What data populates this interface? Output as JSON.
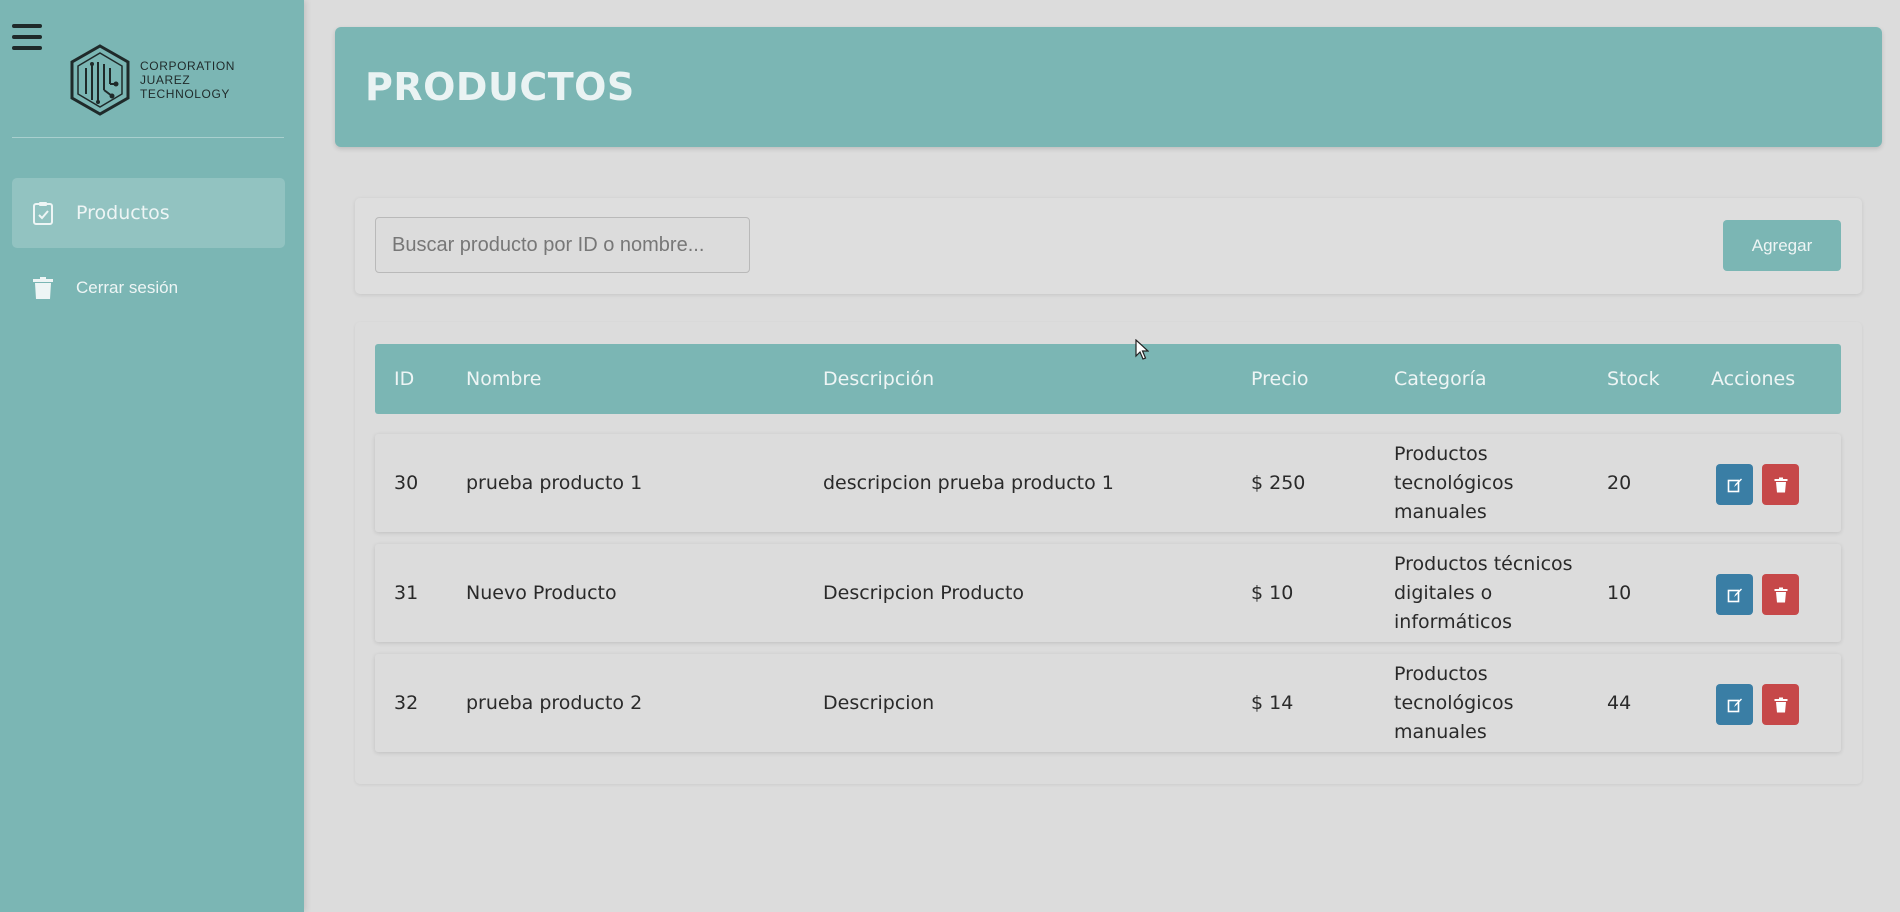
{
  "sidebar": {
    "logo_lines": [
      "CORPORATION",
      "JUAREZ",
      "TECHNOLOGY"
    ],
    "items": [
      {
        "label": "Productos",
        "icon": "clipboard-check-icon",
        "active": true
      },
      {
        "label": "Cerrar sesión",
        "icon": "trash-icon",
        "active": false
      }
    ]
  },
  "header": {
    "title": "PRODUCTOS"
  },
  "toolbar": {
    "search_placeholder": "Buscar producto por ID o nombre...",
    "add_label": "Agregar"
  },
  "table": {
    "columns": [
      "ID",
      "Nombre",
      "Descripción",
      "Precio",
      "Categoría",
      "Stock",
      "Acciones"
    ],
    "rows": [
      {
        "id": "30",
        "nombre": "prueba producto 1",
        "descripcion": "descripcion prueba producto 1",
        "precio": "$ 250",
        "categoria": "Productos tecnológicos manuales",
        "stock": "20"
      },
      {
        "id": "31",
        "nombre": "Nuevo Producto",
        "descripcion": "Descripcion Producto",
        "precio": "$ 10",
        "categoria": "Productos técnicos digitales o informáticos",
        "stock": "10"
      },
      {
        "id": "32",
        "nombre": "prueba producto 2",
        "descripcion": "Descripcion",
        "precio": "$ 14",
        "categoria": "Productos tecnológicos manuales",
        "stock": "44"
      }
    ]
  },
  "colors": {
    "accent": "#7bb6b4",
    "edit": "#3a7ea5",
    "delete": "#c64849",
    "background": "#dcdcdc"
  }
}
